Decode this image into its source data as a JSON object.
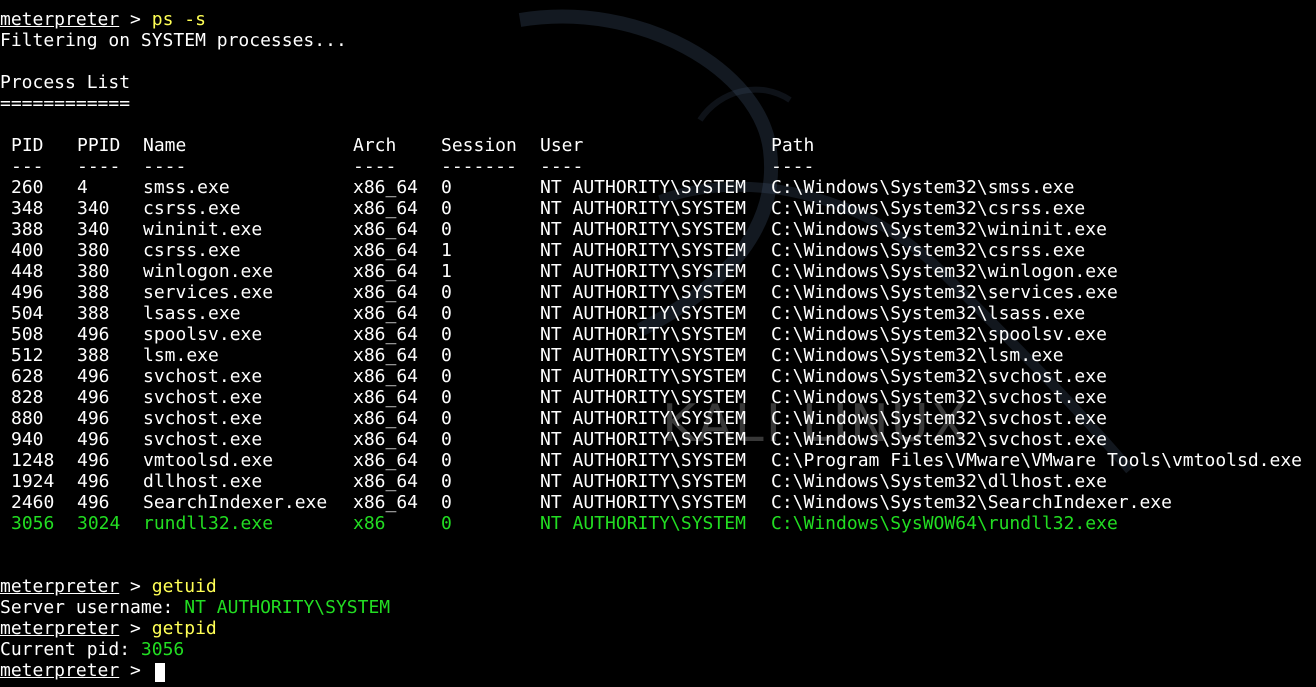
{
  "session1": {
    "prompt": "meterpreter",
    "sep": " > ",
    "cmd": "ps -s",
    "filter_msg": "Filtering on SYSTEM processes...",
    "list_title": "Process List",
    "list_rule": "============"
  },
  "table": {
    "headers": [
      "PID",
      "PPID",
      "Name",
      "Arch",
      "Session",
      "User",
      "Path"
    ],
    "separators": [
      "---",
      "----",
      "----",
      "----",
      "-------",
      "----",
      "----"
    ],
    "rows": [
      [
        "260",
        "4",
        "smss.exe",
        "x86_64",
        "0",
        "NT AUTHORITY\\SYSTEM",
        "C:\\Windows\\System32\\smss.exe"
      ],
      [
        "348",
        "340",
        "csrss.exe",
        "x86_64",
        "0",
        "NT AUTHORITY\\SYSTEM",
        "C:\\Windows\\System32\\csrss.exe"
      ],
      [
        "388",
        "340",
        "wininit.exe",
        "x86_64",
        "0",
        "NT AUTHORITY\\SYSTEM",
        "C:\\Windows\\System32\\wininit.exe"
      ],
      [
        "400",
        "380",
        "csrss.exe",
        "x86_64",
        "1",
        "NT AUTHORITY\\SYSTEM",
        "C:\\Windows\\System32\\csrss.exe"
      ],
      [
        "448",
        "380",
        "winlogon.exe",
        "x86_64",
        "1",
        "NT AUTHORITY\\SYSTEM",
        "C:\\Windows\\System32\\winlogon.exe"
      ],
      [
        "496",
        "388",
        "services.exe",
        "x86_64",
        "0",
        "NT AUTHORITY\\SYSTEM",
        "C:\\Windows\\System32\\services.exe"
      ],
      [
        "504",
        "388",
        "lsass.exe",
        "x86_64",
        "0",
        "NT AUTHORITY\\SYSTEM",
        "C:\\Windows\\System32\\lsass.exe"
      ],
      [
        "508",
        "496",
        "spoolsv.exe",
        "x86_64",
        "0",
        "NT AUTHORITY\\SYSTEM",
        "C:\\Windows\\System32\\spoolsv.exe"
      ],
      [
        "512",
        "388",
        "lsm.exe",
        "x86_64",
        "0",
        "NT AUTHORITY\\SYSTEM",
        "C:\\Windows\\System32\\lsm.exe"
      ],
      [
        "628",
        "496",
        "svchost.exe",
        "x86_64",
        "0",
        "NT AUTHORITY\\SYSTEM",
        "C:\\Windows\\System32\\svchost.exe"
      ],
      [
        "828",
        "496",
        "svchost.exe",
        "x86_64",
        "0",
        "NT AUTHORITY\\SYSTEM",
        "C:\\Windows\\System32\\svchost.exe"
      ],
      [
        "880",
        "496",
        "svchost.exe",
        "x86_64",
        "0",
        "NT AUTHORITY\\SYSTEM",
        "C:\\Windows\\System32\\svchost.exe"
      ],
      [
        "940",
        "496",
        "svchost.exe",
        "x86_64",
        "0",
        "NT AUTHORITY\\SYSTEM",
        "C:\\Windows\\System32\\svchost.exe"
      ],
      [
        "1248",
        "496",
        "vmtoolsd.exe",
        "x86_64",
        "0",
        "NT AUTHORITY\\SYSTEM",
        "C:\\Program Files\\VMware\\VMware Tools\\vmtoolsd.exe"
      ],
      [
        "1924",
        "496",
        "dllhost.exe",
        "x86_64",
        "0",
        "NT AUTHORITY\\SYSTEM",
        "C:\\Windows\\System32\\dllhost.exe"
      ],
      [
        "2460",
        "496",
        "SearchIndexer.exe",
        "x86_64",
        "0",
        "NT AUTHORITY\\SYSTEM",
        "C:\\Windows\\System32\\SearchIndexer.exe"
      ],
      [
        "3056",
        "3024",
        "rundll32.exe",
        "x86",
        "0",
        "NT AUTHORITY\\SYSTEM",
        "C:\\Windows\\SysWOW64\\rundll32.exe"
      ]
    ],
    "highlight_row_index": 16
  },
  "session2": {
    "getuid_prompt": "meterpreter",
    "getuid_cmd": "getuid",
    "server_label": "Server username: ",
    "server_value": "NT AUTHORITY\\SYSTEM",
    "getpid_prompt": "meterpreter",
    "getpid_cmd": "getpid",
    "pid_label": "Current pid: ",
    "pid_value": "3056",
    "final_prompt": "meterpreter",
    "sep": " > "
  },
  "watermark": "KALI LINUX",
  "colors": {
    "background": "#000000",
    "text": "#ffffff",
    "command": "#ffff55",
    "highlight": "#22dd22"
  }
}
